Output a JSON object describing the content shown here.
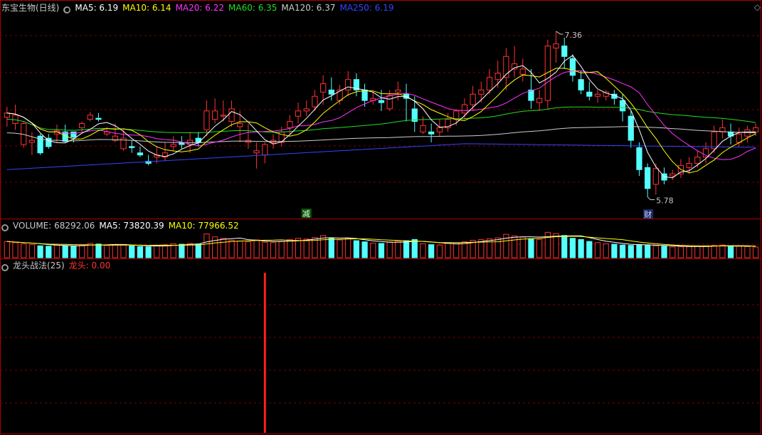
{
  "stock_name": "东宝生物(日线)",
  "ma_legend": [
    {
      "label": "MA5: 6.19",
      "color": "#ffffff"
    },
    {
      "label": "MA10: 6.14",
      "color": "#ffff00"
    },
    {
      "label": "MA20: 6.22",
      "color": "#ff33ff"
    },
    {
      "label": "MA60: 6.35",
      "color": "#22dd22"
    },
    {
      "label": "MA120: 6.37",
      "color": "#cccccc"
    },
    {
      "label": "MA250: 6.19",
      "color": "#3344ff"
    }
  ],
  "volume_header": "VOLUME: 68292.06",
  "volume_ma": [
    {
      "label": "MA5: 73820.39",
      "color": "#ffffff"
    },
    {
      "label": "MA10: 77966.52",
      "color": "#ffff00"
    }
  ],
  "indicator_title": "龙头战法(25)",
  "indicator_value": "龙头: 0.00",
  "annotations": {
    "high": "7.36",
    "low": "5.78",
    "mark_jian": "减",
    "mark_cai": "财"
  },
  "colors": {
    "up": "#ff3232",
    "down": "#54ffff",
    "grid": "#7a0000",
    "border": "#b00000"
  },
  "chart_data": {
    "type": "candlestick",
    "bar_count": 91,
    "price_range": [
      5.58,
      7.55
    ],
    "volume_range": [
      0,
      140000
    ],
    "highest": 7.36,
    "lowest": 5.78,
    "candles": [
      [
        6.54,
        6.64,
        6.58,
        6.45
      ],
      [
        6.48,
        6.66,
        6.56,
        6.42
      ],
      [
        6.28,
        6.5,
        6.48,
        6.25
      ],
      [
        6.3,
        6.4,
        6.32,
        6.18
      ],
      [
        6.36,
        6.38,
        6.2,
        6.18
      ],
      [
        6.34,
        6.38,
        6.26,
        6.24
      ],
      [
        6.38,
        6.47,
        6.41,
        6.3
      ],
      [
        6.4,
        6.47,
        6.31,
        6.3
      ],
      [
        6.4,
        6.4,
        6.35,
        6.3
      ],
      [
        6.44,
        6.5,
        6.48,
        6.4
      ],
      [
        6.52,
        6.59,
        6.56,
        6.5
      ],
      [
        6.53,
        6.58,
        6.52,
        6.5
      ],
      [
        6.38,
        6.45,
        6.4,
        6.36
      ],
      [
        6.32,
        6.48,
        6.36,
        6.3
      ],
      [
        6.24,
        6.42,
        6.34,
        6.22
      ],
      [
        6.26,
        6.32,
        6.25,
        6.2
      ],
      [
        6.2,
        6.26,
        6.18,
        6.16
      ],
      [
        6.12,
        6.18,
        6.1,
        6.08
      ],
      [
        6.16,
        6.26,
        6.18,
        6.1
      ],
      [
        6.16,
        6.3,
        6.2,
        6.12
      ],
      [
        6.26,
        6.36,
        6.28,
        6.22
      ],
      [
        6.3,
        6.36,
        6.28,
        6.24
      ],
      [
        6.28,
        6.4,
        6.32,
        6.2
      ],
      [
        6.34,
        6.4,
        6.3,
        6.26
      ],
      [
        6.42,
        6.7,
        6.6,
        6.36
      ],
      [
        6.52,
        6.72,
        6.6,
        6.48
      ],
      [
        6.55,
        6.7,
        6.56,
        6.5
      ],
      [
        6.5,
        6.7,
        6.62,
        6.45
      ],
      [
        6.45,
        6.6,
        6.48,
        6.3
      ],
      [
        6.3,
        6.48,
        6.32,
        6.24
      ],
      [
        6.2,
        6.3,
        6.22,
        6.05
      ],
      [
        6.18,
        6.3,
        6.28,
        6.1
      ],
      [
        6.3,
        6.38,
        6.32,
        6.24
      ],
      [
        6.3,
        6.45,
        6.4,
        6.26
      ],
      [
        6.44,
        6.56,
        6.5,
        6.38
      ],
      [
        6.55,
        6.68,
        6.6,
        6.48
      ],
      [
        6.6,
        6.7,
        6.62,
        6.55
      ],
      [
        6.64,
        6.8,
        6.74,
        6.6
      ],
      [
        6.78,
        6.94,
        6.86,
        6.66
      ],
      [
        6.8,
        6.92,
        6.76,
        6.7
      ],
      [
        6.7,
        6.85,
        6.8,
        6.66
      ],
      [
        6.8,
        6.98,
        6.9,
        6.74
      ],
      [
        6.9,
        6.96,
        6.8,
        6.74
      ],
      [
        6.8,
        6.86,
        6.7,
        6.64
      ],
      [
        6.7,
        6.78,
        6.72,
        6.66
      ],
      [
        6.7,
        6.8,
        6.68,
        6.6
      ],
      [
        6.62,
        6.8,
        6.75,
        6.6
      ],
      [
        6.78,
        6.88,
        6.8,
        6.7
      ],
      [
        6.76,
        6.86,
        6.72,
        6.5
      ],
      [
        6.62,
        6.74,
        6.5,
        6.4
      ],
      [
        6.4,
        6.55,
        6.46,
        6.38
      ],
      [
        6.4,
        6.48,
        6.38,
        6.3
      ],
      [
        6.4,
        6.52,
        6.44,
        6.36
      ],
      [
        6.44,
        6.58,
        6.52,
        6.4
      ],
      [
        6.52,
        6.62,
        6.6,
        6.46
      ],
      [
        6.58,
        6.72,
        6.66,
        6.52
      ],
      [
        6.66,
        6.84,
        6.76,
        6.6
      ],
      [
        6.76,
        6.88,
        6.8,
        6.68
      ],
      [
        6.8,
        7.0,
        6.92,
        6.76
      ],
      [
        6.9,
        7.08,
        6.96,
        6.82
      ],
      [
        6.92,
        7.2,
        7.12,
        6.8
      ],
      [
        7.0,
        7.22,
        7.05,
        6.92
      ],
      [
        6.95,
        7.1,
        7.0,
        6.88
      ],
      [
        6.8,
        7.0,
        6.7,
        6.62
      ],
      [
        6.68,
        6.8,
        6.72,
        6.6
      ],
      [
        6.7,
        7.28,
        7.22,
        6.62
      ],
      [
        7.2,
        7.36,
        7.24,
        7.06
      ],
      [
        7.22,
        7.3,
        7.12,
        7.0
      ],
      [
        7.1,
        7.14,
        6.94,
        6.88
      ],
      [
        6.9,
        6.98,
        6.8,
        6.76
      ],
      [
        6.78,
        6.88,
        6.74,
        6.7
      ],
      [
        6.74,
        6.8,
        6.76,
        6.68
      ],
      [
        6.74,
        6.8,
        6.78,
        6.7
      ],
      [
        6.76,
        6.8,
        6.72,
        6.66
      ],
      [
        6.7,
        6.76,
        6.6,
        6.5
      ],
      [
        6.55,
        6.6,
        6.32,
        6.25
      ],
      [
        6.25,
        6.3,
        6.04,
        5.98
      ],
      [
        6.06,
        6.1,
        5.86,
        5.78
      ],
      [
        5.9,
        6.1,
        6.05,
        5.8
      ],
      [
        6.0,
        6.06,
        5.94,
        5.9
      ],
      [
        5.98,
        6.04,
        6.0,
        5.94
      ],
      [
        6.0,
        6.14,
        6.08,
        5.96
      ],
      [
        6.06,
        6.16,
        6.1,
        6.0
      ],
      [
        6.1,
        6.22,
        6.16,
        6.06
      ],
      [
        6.16,
        6.3,
        6.24,
        6.1
      ],
      [
        6.24,
        6.46,
        6.4,
        6.2
      ],
      [
        6.4,
        6.52,
        6.44,
        6.34
      ],
      [
        6.4,
        6.48,
        6.36,
        6.28
      ],
      [
        6.3,
        6.44,
        6.38,
        6.26
      ],
      [
        6.36,
        6.46,
        6.42,
        6.3
      ],
      [
        6.4,
        6.48,
        6.44,
        6.36
      ]
    ],
    "volumes": [
      82000,
      76000,
      70000,
      66000,
      60000,
      58000,
      63000,
      61000,
      57000,
      64000,
      72000,
      69000,
      62000,
      66000,
      64000,
      60000,
      56000,
      55000,
      62000,
      65000,
      70000,
      68000,
      72000,
      69000,
      120000,
      105000,
      98000,
      88000,
      84000,
      80000,
      90000,
      78000,
      76000,
      83000,
      92000,
      98000,
      94000,
      102000,
      112000,
      98000,
      90000,
      98000,
      86000,
      80000,
      74000,
      72000,
      80000,
      84000,
      86000,
      92000,
      70000,
      66000,
      64000,
      72000,
      76000,
      80000,
      88000,
      92000,
      96000,
      100000,
      118000,
      110000,
      104000,
      96000,
      92000,
      128000,
      122000,
      112000,
      98000,
      92000,
      82000,
      76000,
      70000,
      68000,
      64000,
      62000,
      66000,
      64000,
      60000,
      58000,
      54000,
      55000,
      56000,
      58000,
      60000,
      62000,
      64000,
      60000,
      58000,
      56000,
      54000
    ],
    "indicator_value": 0,
    "indicator_signal_bar": 31
  }
}
